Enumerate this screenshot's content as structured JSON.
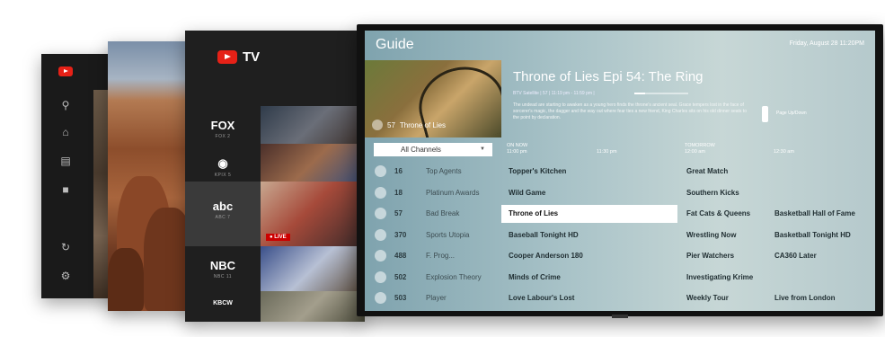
{
  "ytv_sidebar": {
    "icons": [
      "youtube-logo-icon",
      "search-icon",
      "home-icon",
      "subscriptions-icon",
      "library-icon",
      "settings-icon"
    ]
  },
  "ytv": {
    "brand": "TV",
    "channels": [
      {
        "logo": "FOX",
        "sub": "FOX 2"
      },
      {
        "logo": "CBS",
        "sub": "KPIX 5"
      },
      {
        "logo": "abc",
        "sub": "ABC 7"
      },
      {
        "logo": "NBC",
        "sub": "NBC 11"
      },
      {
        "logo": "KBCW",
        "sub": ""
      }
    ],
    "live_label": "● LIVE"
  },
  "guide": {
    "title": "Guide",
    "date": "Friday, August 28  11:20PM",
    "poster_caption_channel": "57",
    "poster_caption_title": "Throne of Lies",
    "show_title": "Throne of Lies Epi 54: The Ring",
    "show_meta": "BTV Satellite | 57 | 11:19 pm - 11:59 pm |",
    "show_progress": 0.2,
    "show_desc": "The undead are starting to awaken as a young hero finds the throne's ancient seal. Grace tempers lost in the face of sorcerer's magic, the dagger and the way out where fear ties a new friend, King Charles sits on his old dinner seats to the point by declaration.",
    "page_hint": "Page Up/Down",
    "filter": "All Channels",
    "times": [
      {
        "top": "ON NOW",
        "bottom": "11:00 pm"
      },
      {
        "top": "",
        "bottom": "11:30 pm"
      },
      {
        "top": "TOMORROW",
        "bottom": "12:00 am"
      },
      {
        "top": "",
        "bottom": "12:30 am"
      }
    ],
    "rows": [
      {
        "num": "16",
        "name": "Top Agents",
        "p1": "Topper's Kitchen",
        "p2": "Great Match",
        "p3": ""
      },
      {
        "num": "18",
        "name": "Platinum Awards",
        "p1": "Wild Game",
        "p2": "Southern Kicks",
        "p3": ""
      },
      {
        "num": "57",
        "name": "Bad Break",
        "p1": "Throne of Lies",
        "p2": "Fat Cats & Queens",
        "p3": "Basketball Hall of Fame"
      },
      {
        "num": "370",
        "name": "Sports Utopia",
        "p1": "Baseball Tonight HD",
        "p2": "Wrestling Now",
        "p3": "Basketball Tonight HD"
      },
      {
        "num": "488",
        "name": "F. Prog...",
        "p1": "Cooper Anderson 180",
        "p2": "Pier Watchers",
        "p3": "CA360 Later"
      },
      {
        "num": "502",
        "name": "Explosion Theory",
        "p1": "Minds of Crime",
        "p2": "Investigating Krime",
        "p3": ""
      },
      {
        "num": "503",
        "name": "Player",
        "p1": "Love Labour's Lost",
        "p2": "Weekly Tour",
        "p3": "Live from London"
      }
    ]
  }
}
